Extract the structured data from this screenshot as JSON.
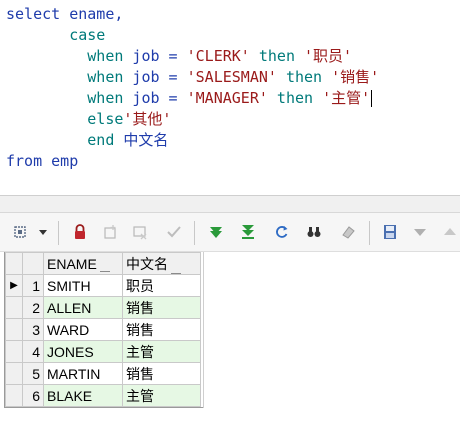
{
  "editor": {
    "line1": {
      "kw": "select",
      "rest": " ename,"
    },
    "line2": {
      "kw": "case"
    },
    "line3": {
      "kw": "when",
      "mid": " job = ",
      "str": "'CLERK'",
      "then": " then ",
      "res": "'职员'"
    },
    "line4": {
      "kw": "when",
      "mid": " job = ",
      "str": "'SALESMAN'",
      "then": " then ",
      "res": "'销售'"
    },
    "line5": {
      "kw": "when",
      "mid": " job = ",
      "str": "'MANAGER'",
      "then": " then ",
      "res": "'主管'"
    },
    "line6": {
      "kw": "else",
      "res": "'其他'"
    },
    "line7": {
      "kw": "end",
      "alias": " 中文名"
    },
    "line8": {
      "kw": "from",
      "rest": " emp"
    }
  },
  "toolbar": {
    "icons": [
      "grid-options-icon",
      "dropdown-arrow-icon",
      "lock-icon",
      "insert-record-icon",
      "delete-record-icon",
      "post-check-icon",
      "next-page-icon",
      "last-page-icon",
      "refresh-icon",
      "find-icon",
      "clear-icon",
      "save-icon",
      "triangle-down-icon",
      "triangle-up-icon"
    ]
  },
  "grid": {
    "columns": [
      "ENAME",
      "中文名"
    ],
    "rows": [
      {
        "num": "1",
        "ename": "SMITH",
        "cn": "职员"
      },
      {
        "num": "2",
        "ename": "ALLEN",
        "cn": "销售"
      },
      {
        "num": "3",
        "ename": "WARD",
        "cn": "销售"
      },
      {
        "num": "4",
        "ename": "JONES",
        "cn": "主管"
      },
      {
        "num": "5",
        "ename": "MARTIN",
        "cn": "销售"
      },
      {
        "num": "6",
        "ename": "BLAKE",
        "cn": "主管"
      }
    ],
    "current_row_marker": "▶"
  }
}
